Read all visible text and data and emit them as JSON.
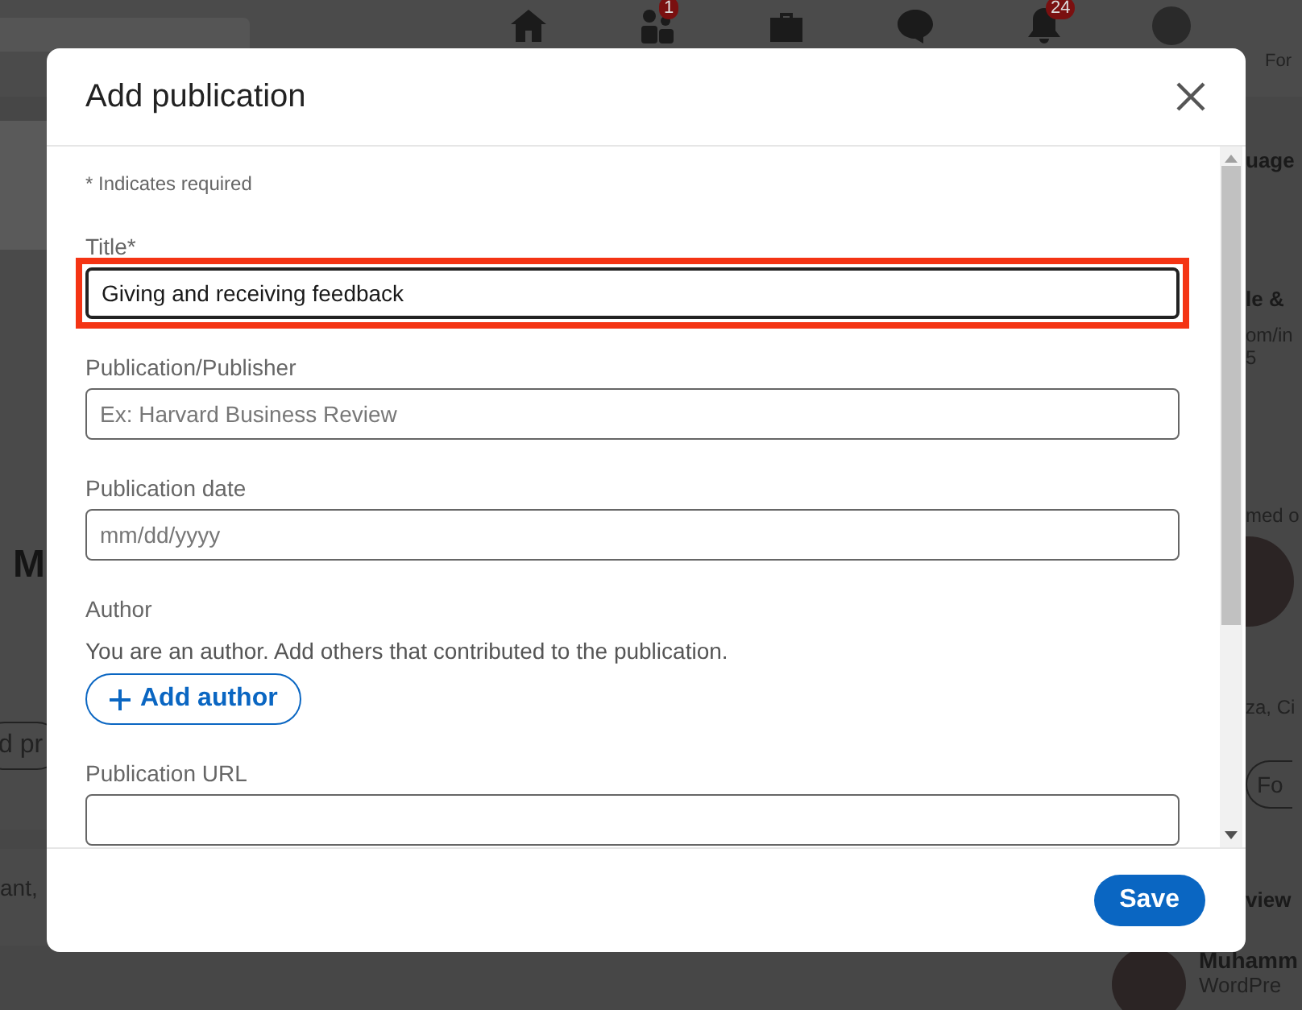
{
  "background": {
    "nav_badges": [
      {
        "count": "1"
      },
      {
        "count": "24"
      }
    ],
    "header_right": "For",
    "left_fragments": [
      {
        "kind": "name",
        "text": "M"
      },
      {
        "kind": "button",
        "text": "d pr"
      },
      {
        "kind": "text",
        "text": "ant, "
      }
    ],
    "right_fragments": [
      {
        "kind": "heading",
        "text": "uage"
      },
      {
        "kind": "heading",
        "text": "le &"
      },
      {
        "kind": "text",
        "text": "om/in"
      },
      {
        "kind": "text",
        "text": "5"
      },
      {
        "kind": "text",
        "text": "med o"
      },
      {
        "kind": "avatar"
      },
      {
        "kind": "text",
        "text": "za, Ci"
      },
      {
        "kind": "button",
        "text": "Fo"
      },
      {
        "kind": "heading",
        "text": "view"
      },
      {
        "kind": "bottom_avatar"
      },
      {
        "kind": "bottom_name",
        "text": "Muhamm"
      },
      {
        "kind": "bottom_text",
        "text": "WordPre"
      }
    ]
  },
  "modal": {
    "title": "Add publication",
    "required_note": "* Indicates required",
    "fields": [
      {
        "kind": "input",
        "label": "Title*",
        "value": "Giving and receiving feedback",
        "highlighted": true
      },
      {
        "kind": "input",
        "label": "Publication/Publisher",
        "placeholder": "Ex: Harvard Business Review",
        "highlighted": false
      },
      {
        "kind": "input",
        "label": "Publication date",
        "placeholder": "mm/dd/yyyy",
        "highlighted": false
      },
      {
        "kind": "author",
        "label": "Author",
        "hint": "You are an author. Add others that contributed to the publication.",
        "button": "Add author"
      },
      {
        "kind": "input",
        "label": "Publication URL",
        "highlighted": false
      }
    ],
    "save_button": "Save"
  }
}
